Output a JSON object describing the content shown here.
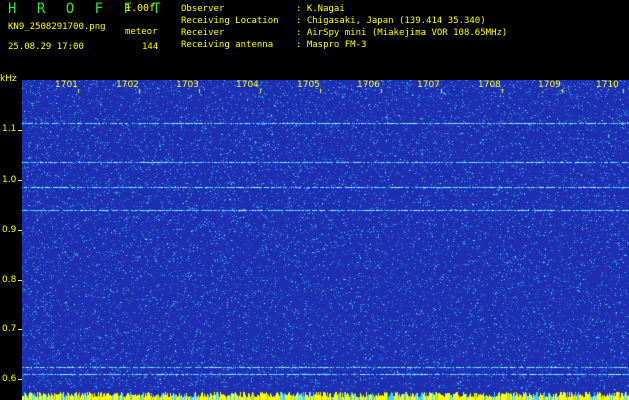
{
  "header": {
    "app_title": "H R O F F T",
    "version": "1.00f",
    "filename": "KN9_2508291700.png",
    "mode": "meteor",
    "datetime": "25.08.29 17:00",
    "count": "144"
  },
  "meta": [
    {
      "label": "Observer",
      "value": ": K.Nagai"
    },
    {
      "label": "Receiving Location",
      "value": ": Chigasaki, Japan (139.414 35.340)"
    },
    {
      "label": "Receiver",
      "value": ": AirSpy mini (Miakejima VOR 108.65MHz)"
    },
    {
      "label": "Receiving antenna",
      "value": ": Maspro FM-3"
    }
  ],
  "axis": {
    "unit": "kHz",
    "y_ticks": [
      "1.1",
      "1.0",
      "0.9",
      "0.8",
      "0.7",
      "0.6"
    ],
    "x_ticks": [
      "1701",
      "1702",
      "1703",
      "1704",
      "1705",
      "1706",
      "1707",
      "1708",
      "1709",
      "1710"
    ]
  },
  "colors": {
    "background": "#1e2fb4",
    "noise": "#2a7fe0",
    "speckle": "#3fd2ff",
    "bright": "#aaffff",
    "label": "#ffff00",
    "title": "#32e632",
    "baseline": "#ffff00"
  },
  "chart_data": {
    "type": "heatmap",
    "ylabel": "kHz",
    "y_ticks": [
      1.1,
      1.0,
      0.9,
      0.8,
      0.7,
      0.6
    ],
    "x_ticks": [
      "1701",
      "1702",
      "1703",
      "1704",
      "1705",
      "1706",
      "1707",
      "1708",
      "1709",
      "1710"
    ],
    "ylim": [
      0.58,
      1.14
    ],
    "horizontal_lines_khz": [
      1.115,
      1.035,
      0.985,
      0.94,
      0.625,
      0.61
    ],
    "grid": false
  }
}
